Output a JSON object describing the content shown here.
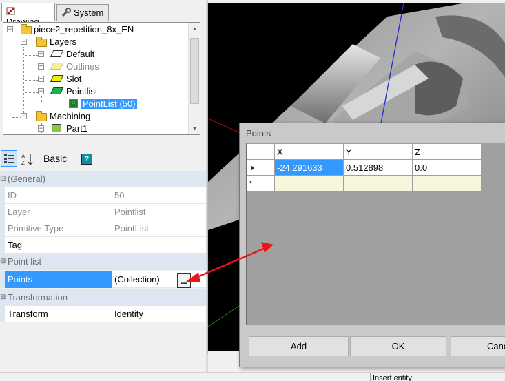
{
  "tabs": [
    {
      "label": "Drawing",
      "active": true
    },
    {
      "label": "System",
      "active": false
    }
  ],
  "tree": {
    "root": "piece2_repetition_8x_EN",
    "layers": "Layers",
    "items": [
      "Default",
      "Outlines",
      "Slot",
      "Pointlist"
    ],
    "pointlist_child": "PointList (50)",
    "machining": "Machining",
    "part": "Part1"
  },
  "toolbar": {
    "basic_label": "Basic",
    "help_label": "?"
  },
  "properties": {
    "general": "(General)",
    "id_key": "ID",
    "id_val": "50",
    "layer_key": "Layer",
    "layer_val": "Pointlist",
    "ptype_key": "Primitive Type",
    "ptype_val": "PointList",
    "tag_key": "Tag",
    "tag_val": "",
    "pointlist_cat": "Point list",
    "points_key": "Points",
    "points_val": "(Collection)",
    "ellipsis": "...",
    "transformation_cat": "Transformation",
    "transform_key": "Transform",
    "transform_val": "Identity"
  },
  "dialog": {
    "title": "Points",
    "columns": [
      "X",
      "Y",
      "Z"
    ],
    "row": {
      "x": "-24.291633",
      "y": "0.512898",
      "z": "0.0"
    },
    "new_row_marker": "*",
    "buttons": {
      "add": "Add",
      "ok": "OK",
      "cancel": "Canc"
    }
  },
  "status": {
    "text": "Insert entity"
  },
  "colors": {
    "selection": "#3399ff",
    "category_bg": "#dde7f2",
    "annotation_arrow": "#e8161b"
  }
}
